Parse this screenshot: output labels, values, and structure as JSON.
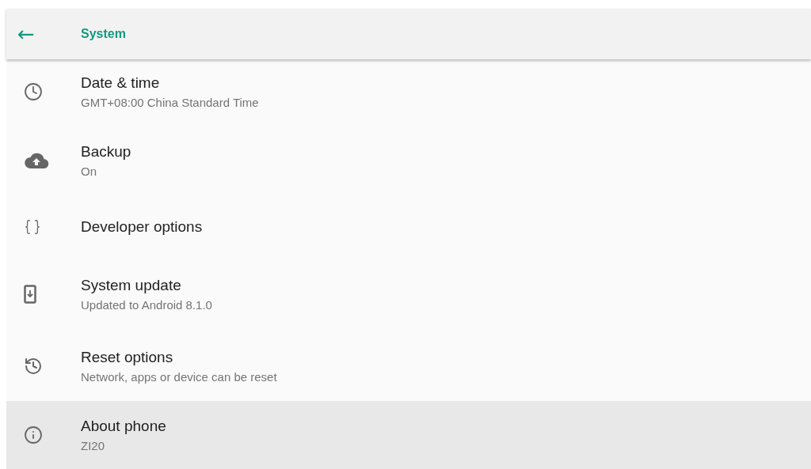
{
  "app_bar": {
    "back": "←",
    "title": "System"
  },
  "items": [
    {
      "title": "Date & time",
      "summary": "GMT+08:00 China Standard Time",
      "selected": false
    },
    {
      "title": "Backup",
      "summary": "On",
      "selected": false
    },
    {
      "title": "Developer options",
      "selected": false
    },
    {
      "title": "System update",
      "summary": "Updated to Android 8.1.0",
      "selected": false
    },
    {
      "title": "Reset options",
      "summary": "Network, apps or device can be reset",
      "selected": false
    },
    {
      "title": "About phone",
      "summary": "ZI20",
      "selected": true
    }
  ]
}
